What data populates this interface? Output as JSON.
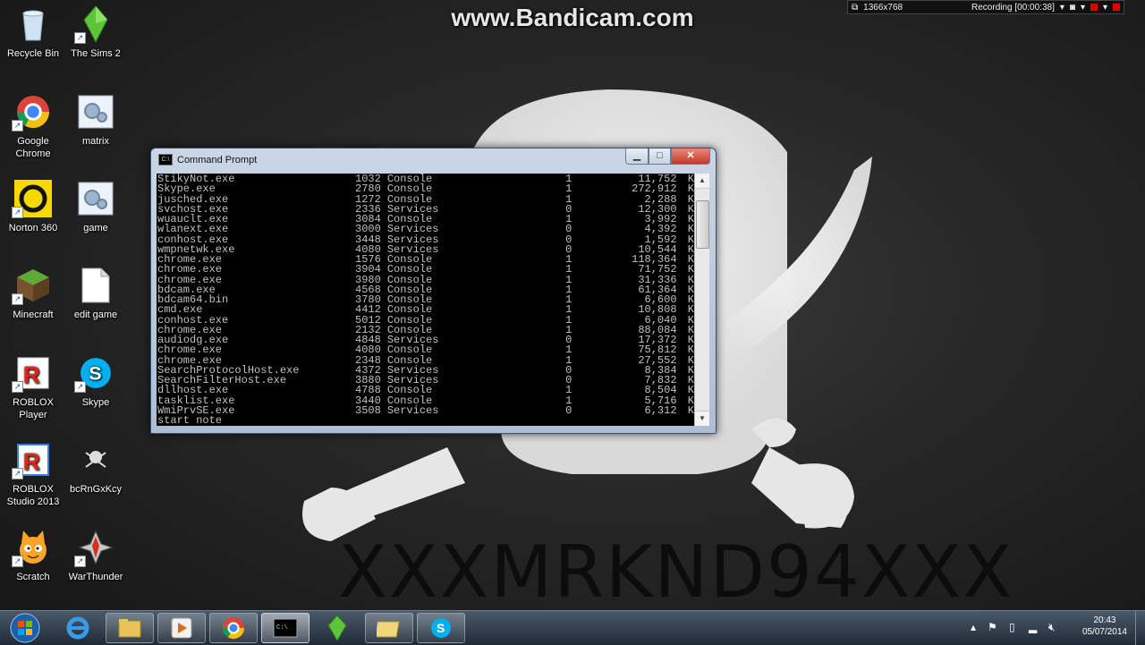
{
  "watermark": "www.Bandicam.com",
  "recording_bar": {
    "resolution": "1366x768",
    "status": "Recording [00:00:38]"
  },
  "wallpaper": {
    "text": "XXXMRKND94XXX"
  },
  "desktop_icons": [
    {
      "label": "Recycle Bin",
      "icon": "recycle-bin-icon"
    },
    {
      "label": "The Sims 2",
      "icon": "sims-diamond-icon"
    },
    {
      "label": "Google\nChrome",
      "icon": "chrome-icon"
    },
    {
      "label": "matrix",
      "icon": "batch-file-icon"
    },
    {
      "label": "Norton 360",
      "icon": "norton-icon"
    },
    {
      "label": "game",
      "icon": "batch-file-icon"
    },
    {
      "label": "Minecraft",
      "icon": "minecraft-icon"
    },
    {
      "label": "edit game",
      "icon": "text-file-icon"
    },
    {
      "label": "ROBLOX\nPlayer",
      "icon": "roblox-icon"
    },
    {
      "label": "Skype",
      "icon": "skype-icon"
    },
    {
      "label": "ROBLOX\nStudio 2013",
      "icon": "roblox-studio-icon"
    },
    {
      "label": "bcRnGxKcy",
      "icon": "pirate-icon"
    },
    {
      "label": "Scratch",
      "icon": "scratch-cat-icon"
    },
    {
      "label": "WarThunder",
      "icon": "warthunder-icon"
    }
  ],
  "cmd_window": {
    "title": "Command Prompt",
    "rows": [
      [
        "StikyNot.exe",
        "1032",
        "Console",
        "1",
        "11,752",
        "K"
      ],
      [
        "Skype.exe",
        "2780",
        "Console",
        "1",
        "272,912",
        "K"
      ],
      [
        "jusched.exe",
        "1272",
        "Console",
        "1",
        "2,288",
        "K"
      ],
      [
        "svchost.exe",
        "2336",
        "Services",
        "0",
        "12,300",
        "K"
      ],
      [
        "wuauclt.exe",
        "3084",
        "Console",
        "1",
        "3,992",
        "K"
      ],
      [
        "wlanext.exe",
        "3000",
        "Services",
        "0",
        "4,392",
        "K"
      ],
      [
        "conhost.exe",
        "3448",
        "Services",
        "0",
        "1,592",
        "K"
      ],
      [
        "wmpnetwk.exe",
        "4080",
        "Services",
        "0",
        "10,544",
        "K"
      ],
      [
        "chrome.exe",
        "1576",
        "Console",
        "1",
        "118,364",
        "K"
      ],
      [
        "chrome.exe",
        "3904",
        "Console",
        "1",
        "71,752",
        "K"
      ],
      [
        "chrome.exe",
        "3980",
        "Console",
        "1",
        "31,336",
        "K"
      ],
      [
        "bdcam.exe",
        "4568",
        "Console",
        "1",
        "61,364",
        "K"
      ],
      [
        "bdcam64.bin",
        "3780",
        "Console",
        "1",
        "6,600",
        "K"
      ],
      [
        "cmd.exe",
        "4412",
        "Console",
        "1",
        "10,808",
        "K"
      ],
      [
        "conhost.exe",
        "5012",
        "Console",
        "1",
        "6,040",
        "K"
      ],
      [
        "chrome.exe",
        "2132",
        "Console",
        "1",
        "88,084",
        "K"
      ],
      [
        "audiodg.exe",
        "4848",
        "Services",
        "0",
        "17,372",
        "K"
      ],
      [
        "chrome.exe",
        "4080",
        "Console",
        "1",
        "75,812",
        "K"
      ],
      [
        "chrome.exe",
        "2348",
        "Console",
        "1",
        "27,552",
        "K"
      ],
      [
        "SearchProtocolHost.exe",
        "4372",
        "Services",
        "0",
        "8,384",
        "K"
      ],
      [
        "SearchFilterHost.exe",
        "3880",
        "Services",
        "0",
        "7,832",
        "K"
      ],
      [
        "dllhost.exe",
        "4788",
        "Console",
        "1",
        "8,504",
        "K"
      ],
      [
        "tasklist.exe",
        "3440",
        "Console",
        "1",
        "5,716",
        "K"
      ],
      [
        "WmiPrvSE.exe",
        "3508",
        "Services",
        "0",
        "6,312",
        "K"
      ]
    ],
    "prompt_line": "start note"
  },
  "taskbar": {
    "pinned": [
      "start-orb-icon",
      "internet-explorer-icon",
      "file-explorer-icon",
      "media-player-icon",
      "chrome-icon",
      "cmd-icon",
      "sims-icon",
      "folder-icon",
      "skype-icon"
    ],
    "clock": {
      "time": "20:43",
      "date": "05/07/2014"
    }
  }
}
